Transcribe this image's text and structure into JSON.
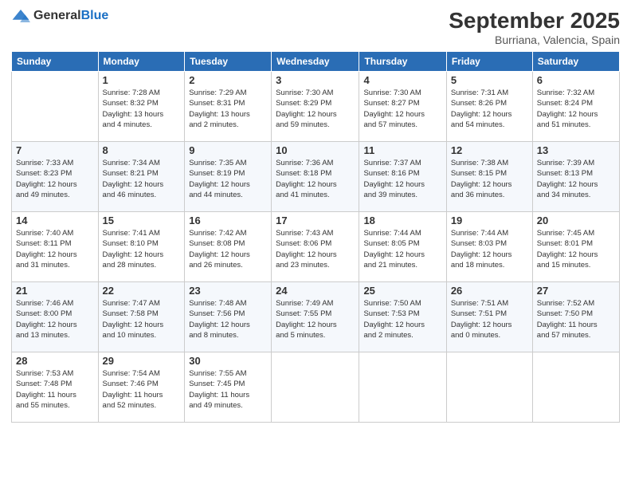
{
  "header": {
    "logo_general": "General",
    "logo_blue": "Blue",
    "month": "September 2025",
    "location": "Burriana, Valencia, Spain"
  },
  "days_of_week": [
    "Sunday",
    "Monday",
    "Tuesday",
    "Wednesday",
    "Thursday",
    "Friday",
    "Saturday"
  ],
  "weeks": [
    [
      {
        "day": "",
        "info": ""
      },
      {
        "day": "1",
        "info": "Sunrise: 7:28 AM\nSunset: 8:32 PM\nDaylight: 13 hours\nand 4 minutes."
      },
      {
        "day": "2",
        "info": "Sunrise: 7:29 AM\nSunset: 8:31 PM\nDaylight: 13 hours\nand 2 minutes."
      },
      {
        "day": "3",
        "info": "Sunrise: 7:30 AM\nSunset: 8:29 PM\nDaylight: 12 hours\nand 59 minutes."
      },
      {
        "day": "4",
        "info": "Sunrise: 7:30 AM\nSunset: 8:27 PM\nDaylight: 12 hours\nand 57 minutes."
      },
      {
        "day": "5",
        "info": "Sunrise: 7:31 AM\nSunset: 8:26 PM\nDaylight: 12 hours\nand 54 minutes."
      },
      {
        "day": "6",
        "info": "Sunrise: 7:32 AM\nSunset: 8:24 PM\nDaylight: 12 hours\nand 51 minutes."
      }
    ],
    [
      {
        "day": "7",
        "info": "Sunrise: 7:33 AM\nSunset: 8:23 PM\nDaylight: 12 hours\nand 49 minutes."
      },
      {
        "day": "8",
        "info": "Sunrise: 7:34 AM\nSunset: 8:21 PM\nDaylight: 12 hours\nand 46 minutes."
      },
      {
        "day": "9",
        "info": "Sunrise: 7:35 AM\nSunset: 8:19 PM\nDaylight: 12 hours\nand 44 minutes."
      },
      {
        "day": "10",
        "info": "Sunrise: 7:36 AM\nSunset: 8:18 PM\nDaylight: 12 hours\nand 41 minutes."
      },
      {
        "day": "11",
        "info": "Sunrise: 7:37 AM\nSunset: 8:16 PM\nDaylight: 12 hours\nand 39 minutes."
      },
      {
        "day": "12",
        "info": "Sunrise: 7:38 AM\nSunset: 8:15 PM\nDaylight: 12 hours\nand 36 minutes."
      },
      {
        "day": "13",
        "info": "Sunrise: 7:39 AM\nSunset: 8:13 PM\nDaylight: 12 hours\nand 34 minutes."
      }
    ],
    [
      {
        "day": "14",
        "info": "Sunrise: 7:40 AM\nSunset: 8:11 PM\nDaylight: 12 hours\nand 31 minutes."
      },
      {
        "day": "15",
        "info": "Sunrise: 7:41 AM\nSunset: 8:10 PM\nDaylight: 12 hours\nand 28 minutes."
      },
      {
        "day": "16",
        "info": "Sunrise: 7:42 AM\nSunset: 8:08 PM\nDaylight: 12 hours\nand 26 minutes."
      },
      {
        "day": "17",
        "info": "Sunrise: 7:43 AM\nSunset: 8:06 PM\nDaylight: 12 hours\nand 23 minutes."
      },
      {
        "day": "18",
        "info": "Sunrise: 7:44 AM\nSunset: 8:05 PM\nDaylight: 12 hours\nand 21 minutes."
      },
      {
        "day": "19",
        "info": "Sunrise: 7:44 AM\nSunset: 8:03 PM\nDaylight: 12 hours\nand 18 minutes."
      },
      {
        "day": "20",
        "info": "Sunrise: 7:45 AM\nSunset: 8:01 PM\nDaylight: 12 hours\nand 15 minutes."
      }
    ],
    [
      {
        "day": "21",
        "info": "Sunrise: 7:46 AM\nSunset: 8:00 PM\nDaylight: 12 hours\nand 13 minutes."
      },
      {
        "day": "22",
        "info": "Sunrise: 7:47 AM\nSunset: 7:58 PM\nDaylight: 12 hours\nand 10 minutes."
      },
      {
        "day": "23",
        "info": "Sunrise: 7:48 AM\nSunset: 7:56 PM\nDaylight: 12 hours\nand 8 minutes."
      },
      {
        "day": "24",
        "info": "Sunrise: 7:49 AM\nSunset: 7:55 PM\nDaylight: 12 hours\nand 5 minutes."
      },
      {
        "day": "25",
        "info": "Sunrise: 7:50 AM\nSunset: 7:53 PM\nDaylight: 12 hours\nand 2 minutes."
      },
      {
        "day": "26",
        "info": "Sunrise: 7:51 AM\nSunset: 7:51 PM\nDaylight: 12 hours\nand 0 minutes."
      },
      {
        "day": "27",
        "info": "Sunrise: 7:52 AM\nSunset: 7:50 PM\nDaylight: 11 hours\nand 57 minutes."
      }
    ],
    [
      {
        "day": "28",
        "info": "Sunrise: 7:53 AM\nSunset: 7:48 PM\nDaylight: 11 hours\nand 55 minutes."
      },
      {
        "day": "29",
        "info": "Sunrise: 7:54 AM\nSunset: 7:46 PM\nDaylight: 11 hours\nand 52 minutes."
      },
      {
        "day": "30",
        "info": "Sunrise: 7:55 AM\nSunset: 7:45 PM\nDaylight: 11 hours\nand 49 minutes."
      },
      {
        "day": "",
        "info": ""
      },
      {
        "day": "",
        "info": ""
      },
      {
        "day": "",
        "info": ""
      },
      {
        "day": "",
        "info": ""
      }
    ]
  ]
}
